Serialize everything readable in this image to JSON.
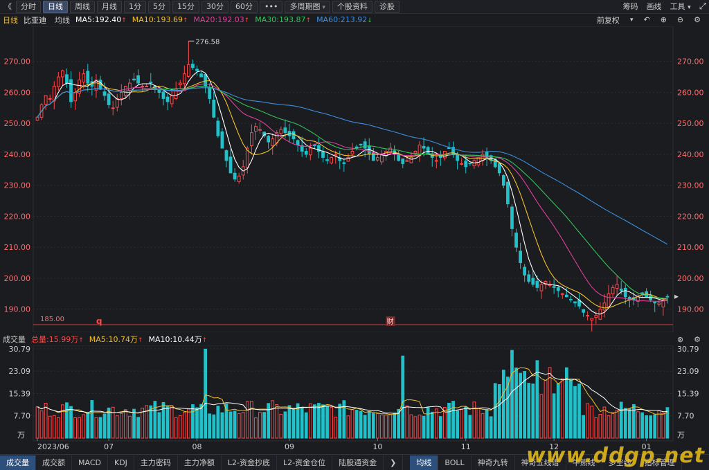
{
  "toolbar": {
    "back_glyph": "《",
    "periods": [
      {
        "label": "分时",
        "active": false
      },
      {
        "label": "日线",
        "active": true
      },
      {
        "label": "周线",
        "active": false
      },
      {
        "label": "月线",
        "active": false
      },
      {
        "label": "1分",
        "active": false
      },
      {
        "label": "5分",
        "active": false
      },
      {
        "label": "15分",
        "active": false
      },
      {
        "label": "30分",
        "active": false
      },
      {
        "label": "60分",
        "active": false
      },
      {
        "label": "•••",
        "active": false
      },
      {
        "label": "多周期图",
        "active": false,
        "dropdown": true
      },
      {
        "label": "个股资料",
        "active": false
      },
      {
        "label": "诊股",
        "active": false
      }
    ],
    "right": [
      "筹码",
      "画线",
      "工具"
    ]
  },
  "ma_header": {
    "period": "日线",
    "stock": "比亚迪",
    "mode": "均线",
    "items": [
      {
        "label": "MA5:192.40",
        "color": "#ffffff",
        "dir": "up"
      },
      {
        "label": "MA10:193.69",
        "color": "#f2c12e",
        "dir": "up"
      },
      {
        "label": "MA20:192.03",
        "color": "#e0409a",
        "dir": "up"
      },
      {
        "label": "MA30:193.87",
        "color": "#35c45a",
        "dir": "up"
      },
      {
        "label": "MA60:213.92",
        "color": "#3d8fe0",
        "dir": "down"
      }
    ],
    "adjust": "前复权"
  },
  "vol_header": {
    "title": "成交量",
    "items": [
      {
        "label": "总量:15.99万",
        "color": "#ff4848",
        "dir": "up"
      },
      {
        "label": "MA5:10.74万",
        "color": "#f2c12e",
        "dir": "up"
      },
      {
        "label": "MA10:10.44万",
        "color": "#ffffff",
        "dir": "up"
      }
    ]
  },
  "colors": {
    "up": "#ff4848",
    "down": "#22c0c8",
    "ma5": "#ffffff",
    "ma10": "#f2c12e",
    "ma20": "#e0409a",
    "ma30": "#35c45a",
    "ma60": "#3d8fe0",
    "grid": "#2c2d33",
    "axis_text": "#ff6b6b"
  },
  "chart_data": {
    "type": "candlestick",
    "price_axis": {
      "ticks": [
        "270.00",
        "260.00",
        "250.00",
        "240.00",
        "230.00",
        "220.00",
        "210.00",
        "200.00",
        "190.00"
      ],
      "range": [
        183,
        280
      ]
    },
    "volume_axis": {
      "ticks": [
        "30.79",
        "23.09",
        "15.39",
        "7.70"
      ],
      "unit": "万",
      "range": [
        0,
        31
      ]
    },
    "x_labels": [
      "2023/06",
      "07",
      "08",
      "09",
      "10",
      "11",
      "12",
      "01"
    ],
    "x_label_index": [
      0,
      17,
      38,
      60,
      81,
      102,
      123,
      145
    ],
    "annotations": {
      "high": "276.58",
      "low": "182.85",
      "line_value": "185.00",
      "marker_q": "q",
      "marker_cai": "财"
    },
    "close_path": [
      252,
      256,
      259,
      258,
      262,
      265,
      267,
      263,
      257,
      260,
      264,
      266,
      263,
      262,
      264,
      261,
      259,
      256,
      255,
      258,
      260,
      262,
      263,
      264,
      263,
      262,
      262,
      263,
      261,
      260,
      258,
      257,
      259,
      261,
      263,
      266,
      269,
      268,
      267,
      265,
      262,
      258,
      252,
      246,
      242,
      238,
      234,
      232,
      233,
      236,
      242,
      247,
      249,
      248,
      246,
      244,
      245,
      247,
      248,
      247,
      246,
      245,
      243,
      241,
      240,
      242,
      243,
      241,
      239,
      238,
      239,
      240,
      238,
      237,
      239,
      241,
      242,
      243,
      242,
      240,
      238,
      239,
      240,
      241,
      242,
      240,
      238,
      237,
      238,
      239,
      241,
      243,
      242,
      240,
      239,
      238,
      239,
      241,
      242,
      240,
      238,
      237,
      236,
      237,
      238,
      239,
      240,
      239,
      238,
      236,
      234,
      230,
      224,
      216,
      210,
      205,
      201,
      199,
      198,
      197,
      198,
      199,
      198,
      197,
      196,
      195,
      194,
      193,
      192,
      191,
      189,
      188,
      187,
      188,
      190,
      192,
      195,
      197,
      198,
      196,
      194,
      193,
      193,
      194,
      195,
      194,
      193,
      192,
      192,
      193,
      194
    ]
  },
  "bottom_tabs": {
    "left": [
      {
        "label": "成交量",
        "active": true
      },
      {
        "label": "成交额"
      },
      {
        "label": "MACD"
      },
      {
        "label": "KDJ"
      },
      {
        "label": "主力密码"
      },
      {
        "label": "主力净额"
      },
      {
        "label": "L2-资金抄底"
      },
      {
        "label": "L2-资金仓位"
      },
      {
        "label": "陆股通资金"
      }
    ],
    "right": [
      {
        "label": "均线",
        "active": true
      },
      {
        "label": "BOLL"
      },
      {
        "label": "神奇九转"
      },
      {
        "label": "神奇五线谱"
      },
      {
        "label": "牛熊线"
      },
      {
        "label": "多空线"
      },
      {
        "label": "指标管理"
      }
    ],
    "more_glyph": "❯"
  },
  "watermark": "www.ddgp.net"
}
